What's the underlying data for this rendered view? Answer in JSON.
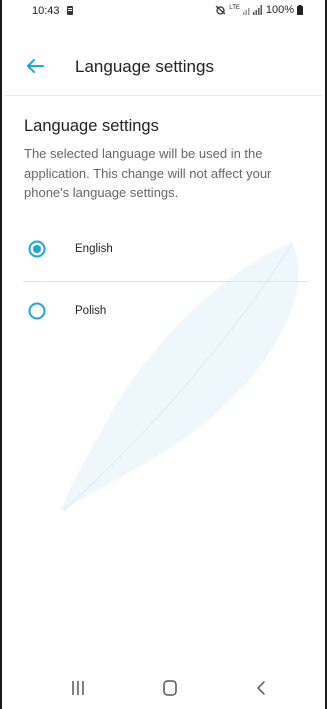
{
  "status_bar": {
    "time": "10:43",
    "battery": "100%",
    "network": "LTE"
  },
  "header": {
    "title": "Language settings",
    "back_icon": "arrow-left-icon"
  },
  "section": {
    "title": "Language settings",
    "description": "The selected language will be used in the application. This change will not affect your phone's language settings."
  },
  "options": [
    {
      "label": "English",
      "selected": true
    },
    {
      "label": "Polish",
      "selected": false
    }
  ],
  "colors": {
    "accent": "#1aa9d6",
    "watermark": "#eef7fb",
    "divider": "#e3e3e3"
  },
  "nav_bar": {
    "items": [
      "recents-icon",
      "home-icon",
      "back-icon"
    ]
  }
}
